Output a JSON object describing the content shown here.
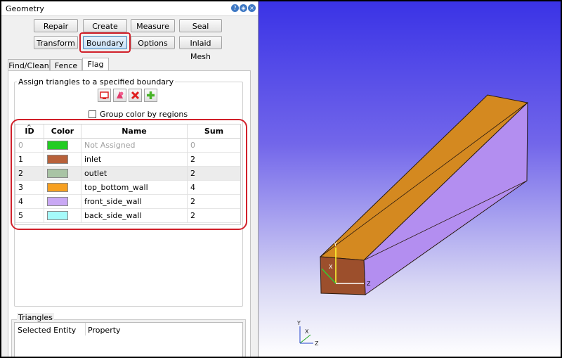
{
  "window": {
    "title": "Geometry"
  },
  "toolbar": {
    "row1": [
      "Repair",
      "Create",
      "Measure",
      "Seal"
    ],
    "row2": [
      "Transform",
      "Boundary",
      "Options",
      "Inlaid Mesh"
    ],
    "active": "Boundary"
  },
  "tabs": [
    "Find/Clean",
    "Fence",
    "Flag"
  ],
  "active_tab": "Flag",
  "flag": {
    "group_title": "Assign triangles to a specified boundary",
    "icons": [
      "remove-boundary-icon",
      "assign-flag-icon",
      "delete-icon",
      "add-icon"
    ],
    "group_color_checkbox": {
      "label": "Group color by regions",
      "checked": false
    },
    "table": {
      "columns": [
        "ID",
        "Color",
        "Name",
        "Sum"
      ],
      "rows": [
        {
          "id": "0",
          "color": "#22cc22",
          "name": "Not Assigned",
          "sum": "0"
        },
        {
          "id": "1",
          "color": "#b8613a",
          "name": "inlet",
          "sum": "2"
        },
        {
          "id": "2",
          "color": "#a9c4a5",
          "name": "outlet",
          "sum": "2"
        },
        {
          "id": "3",
          "color": "#f7a020",
          "name": "top_bottom_wall",
          "sum": "4"
        },
        {
          "id": "4",
          "color": "#c9a8f4",
          "name": "front_side_wall",
          "sum": "2"
        },
        {
          "id": "5",
          "color": "#a5fafa",
          "name": "back_side_wall",
          "sum": "2"
        }
      ]
    }
  },
  "triangles": {
    "title": "Triangles",
    "columns": [
      "Selected Entity",
      "Property"
    ]
  },
  "viewport": {
    "model_axes": [
      "Y",
      "X",
      "Z"
    ],
    "triad_axes": [
      "Y",
      "X",
      "Z"
    ]
  },
  "colors": {
    "highlight": "#d1202a",
    "background_top": "#3a33e6",
    "background_bottom": "#ffffff"
  }
}
